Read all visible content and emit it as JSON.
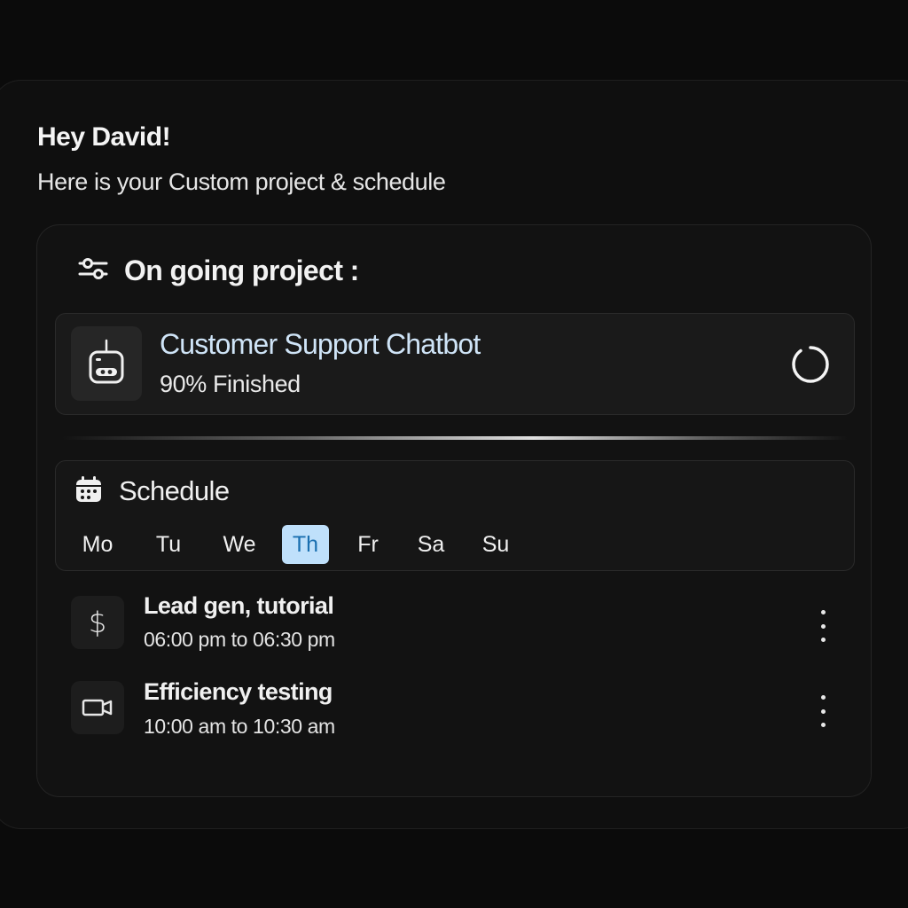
{
  "header": {
    "greeting": "Hey David!",
    "subtitle": "Here is your Custom project & schedule"
  },
  "ongoing": {
    "title": "On going project :",
    "icon": "sliders-icon",
    "project": {
      "name": "Customer Support Chatbot",
      "progress_text": "90% Finished",
      "progress": 0.9,
      "icon": "robot-icon",
      "status_icon": "loading-ring-icon"
    }
  },
  "schedule": {
    "title": "Schedule",
    "icon": "calendar-icon",
    "days": [
      "Mo",
      "Tu",
      "We",
      "Th",
      "Fr",
      "Sa",
      "Su"
    ],
    "selected_day": "Th",
    "events": [
      {
        "title": "Lead gen, tutorial",
        "time": "06:00 pm to  06:30 pm",
        "icon": "dollar-icon"
      },
      {
        "title": "Efficiency testing",
        "time": "10:00 am to  10:30 am",
        "icon": "video-camera-icon"
      }
    ]
  },
  "colors": {
    "background": "#0b0b0b",
    "project_name": "#cfe4f7",
    "day_active_bg": "#bfe0fb",
    "day_active_text": "#1a6fb0"
  }
}
